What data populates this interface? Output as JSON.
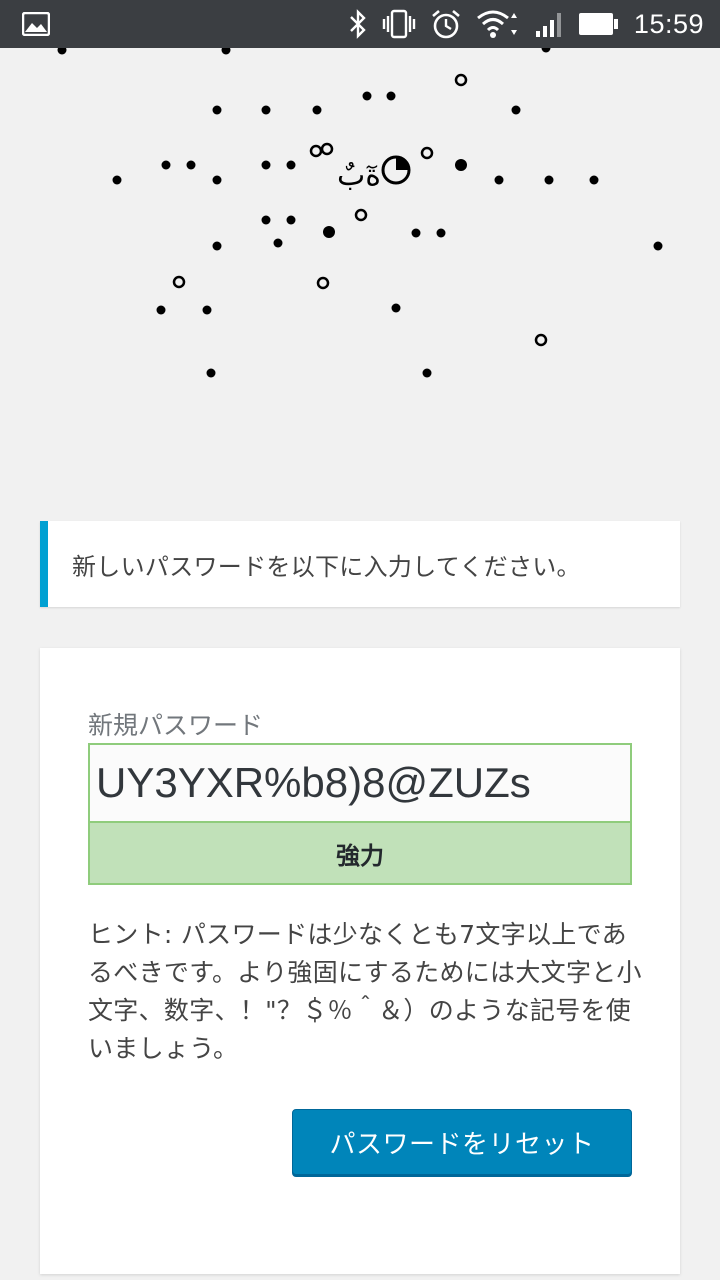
{
  "statusbar": {
    "time": "15:59",
    "icons": [
      "image-icon",
      "bluetooth-icon",
      "vibrate-icon",
      "alarm-icon",
      "wifi-icon",
      "signal-icon",
      "battery-icon"
    ]
  },
  "logo": {
    "glyph": "ةٓبٌ"
  },
  "notice": {
    "message": "新しいパスワードを以下に入力してください。",
    "accent_color": "#00a0d2"
  },
  "form": {
    "password_label": "新規パスワード",
    "password_value": "UY3YXR%b8)8@ZUZs",
    "strength_label": "強力",
    "strength_color": "#c1e1b9",
    "hint": "ヒント: パスワードは少なくとも7文字以上であるべきです。より強固にするためには大文字と小文字、数字、！\"？＄％＾＆）のような記号を使いましょう。",
    "submit_label": "パスワードをリセット",
    "submit_color": "#0085ba"
  }
}
